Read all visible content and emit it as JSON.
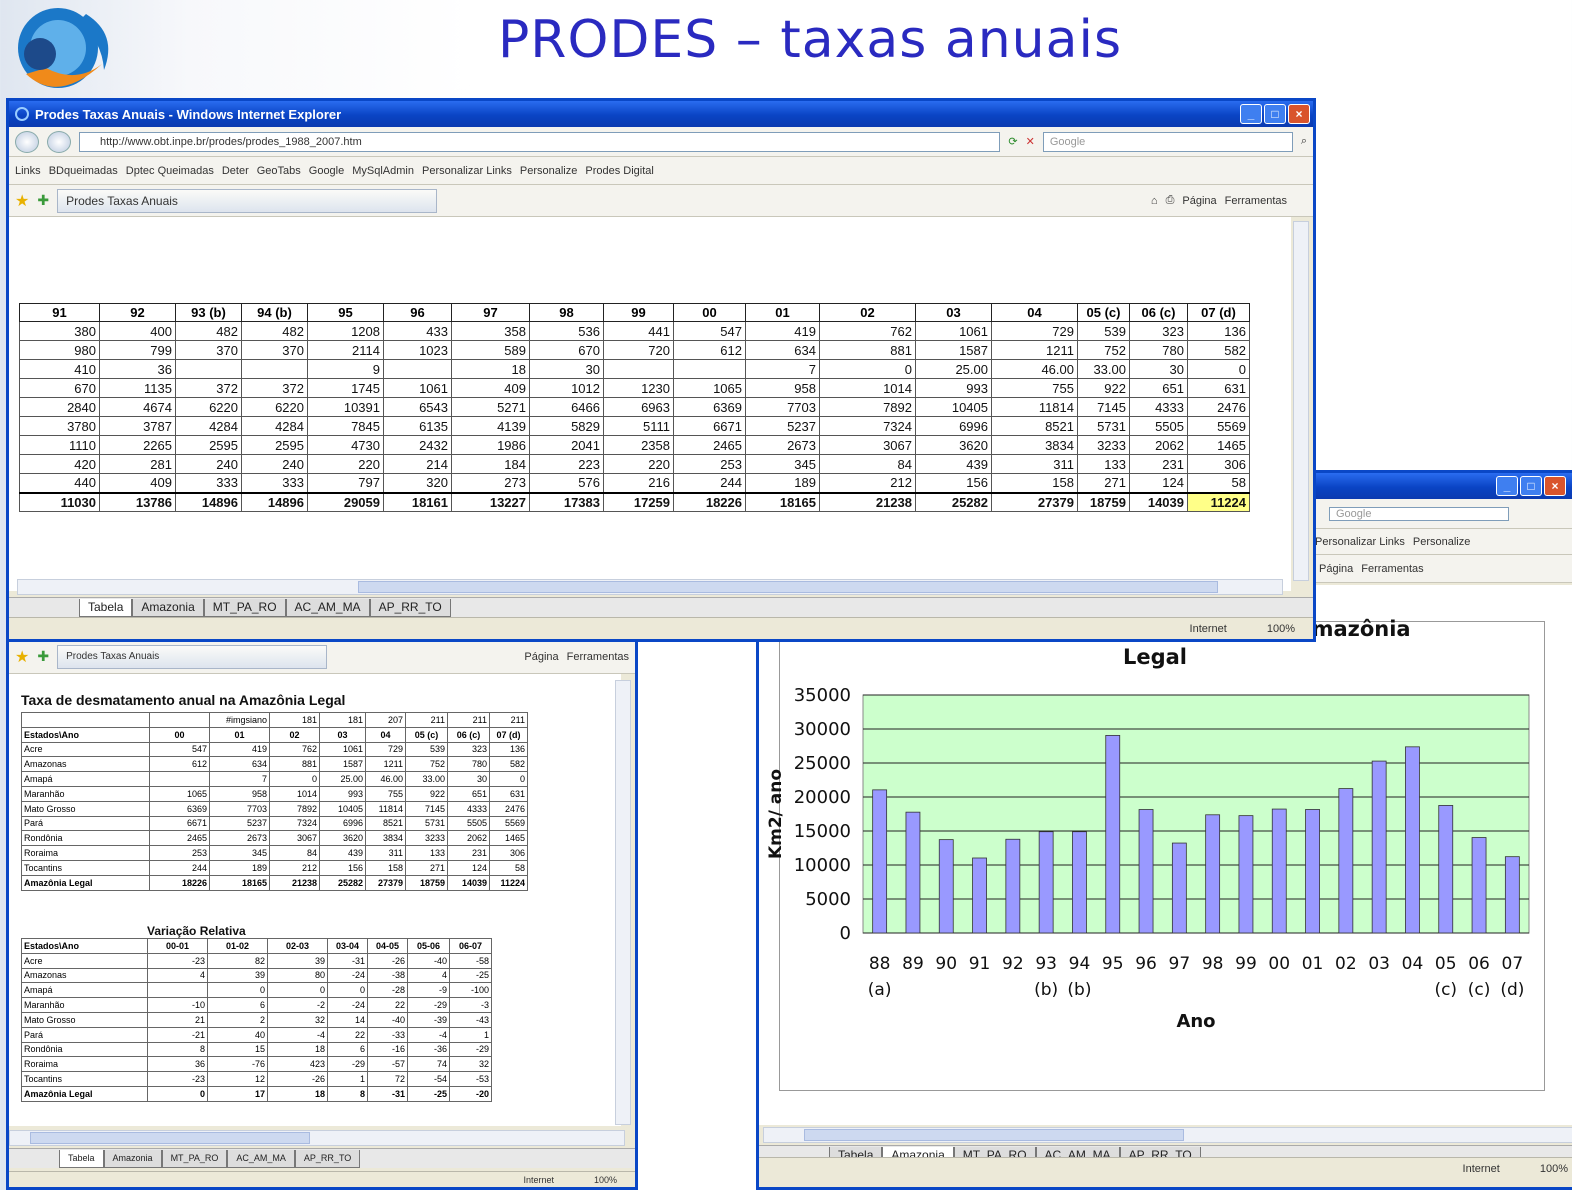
{
  "slide": {
    "title": "PRODES – taxas anuais"
  },
  "main_window": {
    "title": "Prodes Taxas Anuais - Windows Internet Explorer",
    "address": "http://www.obt.inpe.br/prodes/prodes_1988_2007.htm",
    "search_placeholder": "Google",
    "links": [
      "Links",
      "BDqueimadas",
      "Dptec Queimadas",
      "Deter",
      "GeoTabs",
      "Google",
      "MySqlAdmin",
      "Personalizar Links",
      "Personalize",
      "Prodes Digital"
    ],
    "tab_label": "Prodes Taxas Anuais",
    "cmd": [
      "Página",
      "Ferramentas"
    ],
    "status_zone": "Internet",
    "zoom": "100%",
    "sheet_tabs": [
      "Tabela",
      "Amazonia",
      "MT_PA_RO",
      "AC_AM_MA",
      "AP_RR_TO"
    ],
    "table": {
      "headers": [
        "91",
        "92",
        "93 (b)",
        "94 (b)",
        "95",
        "96",
        "97",
        "98",
        "99",
        "00",
        "01",
        "02",
        "03",
        "04",
        "05 (c)",
        "06 (c)",
        "07 (d)"
      ],
      "rows": [
        [
          "380",
          "400",
          "482",
          "482",
          "1208",
          "433",
          "358",
          "536",
          "441",
          "547",
          "419",
          "762",
          "1061",
          "729",
          "539",
          "323",
          "136"
        ],
        [
          "980",
          "799",
          "370",
          "370",
          "2114",
          "1023",
          "589",
          "670",
          "720",
          "612",
          "634",
          "881",
          "1587",
          "1211",
          "752",
          "780",
          "582"
        ],
        [
          "410",
          "36",
          "",
          "",
          "9",
          "",
          "18",
          "30",
          "",
          "",
          "7",
          "0",
          "25.00",
          "46.00",
          "33.00",
          "30",
          "0"
        ],
        [
          "670",
          "1135",
          "372",
          "372",
          "1745",
          "1061",
          "409",
          "1012",
          "1230",
          "1065",
          "958",
          "1014",
          "993",
          "755",
          "922",
          "651",
          "631"
        ],
        [
          "2840",
          "4674",
          "6220",
          "6220",
          "10391",
          "6543",
          "5271",
          "6466",
          "6963",
          "6369",
          "7703",
          "7892",
          "10405",
          "11814",
          "7145",
          "4333",
          "2476"
        ],
        [
          "3780",
          "3787",
          "4284",
          "4284",
          "7845",
          "6135",
          "4139",
          "5829",
          "5111",
          "6671",
          "5237",
          "7324",
          "6996",
          "8521",
          "5731",
          "5505",
          "5569"
        ],
        [
          "1110",
          "2265",
          "2595",
          "2595",
          "4730",
          "2432",
          "1986",
          "2041",
          "2358",
          "2465",
          "2673",
          "3067",
          "3620",
          "3834",
          "3233",
          "2062",
          "1465"
        ],
        [
          "420",
          "281",
          "240",
          "240",
          "220",
          "214",
          "184",
          "223",
          "220",
          "253",
          "345",
          "84",
          "439",
          "311",
          "133",
          "231",
          "306"
        ],
        [
          "440",
          "409",
          "333",
          "333",
          "797",
          "320",
          "273",
          "576",
          "216",
          "244",
          "189",
          "212",
          "156",
          "158",
          "271",
          "124",
          "58"
        ]
      ],
      "totals": [
        "11030",
        "13786",
        "14896",
        "14896",
        "29059",
        "18161",
        "13227",
        "17383",
        "17259",
        "18226",
        "18165",
        "21238",
        "25282",
        "27379",
        "18759",
        "14039",
        "11224"
      ]
    }
  },
  "left_window": {
    "tab_label": "Prodes Taxas Anuais",
    "cmd": [
      "Página",
      "Ferramentas"
    ],
    "status_zone": "Internet",
    "zoom": "100%",
    "sheet_tabs": [
      "Tabela",
      "Amazonia",
      "MT_PA_RO",
      "AC_AM_MA",
      "AP_RR_TO"
    ],
    "table1": {
      "title": "Taxa de desmatamento anual  na Amazônia Legal",
      "pre": [
        "#imgsiano",
        "181",
        "181",
        "207",
        "211",
        "211",
        "211"
      ],
      "headers": [
        "Estados\\Ano",
        "00",
        "01",
        "02",
        "03",
        "04",
        "05 (c)",
        "06 (c)",
        "07 (d)"
      ],
      "rows": [
        [
          "Acre",
          "547",
          "419",
          "762",
          "1061",
          "729",
          "539",
          "323",
          "136"
        ],
        [
          "Amazonas",
          "612",
          "634",
          "881",
          "1587",
          "1211",
          "752",
          "780",
          "582"
        ],
        [
          "Amapá",
          "",
          "7",
          "0",
          "25.00",
          "46.00",
          "33.00",
          "30",
          "0"
        ],
        [
          "Maranhão",
          "1065",
          "958",
          "1014",
          "993",
          "755",
          "922",
          "651",
          "631"
        ],
        [
          "Mato Grosso",
          "6369",
          "7703",
          "7892",
          "10405",
          "11814",
          "7145",
          "4333",
          "2476"
        ],
        [
          "Pará",
          "6671",
          "5237",
          "7324",
          "6996",
          "8521",
          "5731",
          "5505",
          "5569"
        ],
        [
          "Rondônia",
          "2465",
          "2673",
          "3067",
          "3620",
          "3834",
          "3233",
          "2062",
          "1465"
        ],
        [
          "Roraima",
          "253",
          "345",
          "84",
          "439",
          "311",
          "133",
          "231",
          "306"
        ],
        [
          "Tocantins",
          "244",
          "189",
          "212",
          "156",
          "158",
          "271",
          "124",
          "58"
        ]
      ],
      "total": [
        "Amazônia Legal",
        "18226",
        "18165",
        "21238",
        "25282",
        "27379",
        "18759",
        "14039",
        "11224"
      ]
    },
    "table2": {
      "title": "Variação Relativa",
      "headers": [
        "Estados\\Ano",
        "00-01",
        "01-02",
        "02-03",
        "03-04",
        "04-05",
        "05-06",
        "06-07"
      ],
      "rows": [
        [
          "Acre",
          "-23",
          "82",
          "39",
          "-31",
          "-26",
          "-40",
          "-58"
        ],
        [
          "Amazonas",
          "4",
          "39",
          "80",
          "-24",
          "-38",
          "4",
          "-25"
        ],
        [
          "Amapá",
          "",
          "0",
          "0",
          "0",
          "-28",
          "-9",
          "-100"
        ],
        [
          "Maranhão",
          "-10",
          "6",
          "-2",
          "-24",
          "22",
          "-29",
          "-3"
        ],
        [
          "Mato Grosso",
          "21",
          "2",
          "32",
          "14",
          "-40",
          "-39",
          "-43"
        ],
        [
          "Pará",
          "-21",
          "40",
          "-4",
          "22",
          "-33",
          "-4",
          "1"
        ],
        [
          "Rondônia",
          "8",
          "15",
          "18",
          "6",
          "-16",
          "-36",
          "-29"
        ],
        [
          "Roraima",
          "36",
          "-76",
          "423",
          "-29",
          "-57",
          "74",
          "32"
        ],
        [
          "Tocantins",
          "-23",
          "12",
          "-26",
          "1",
          "72",
          "-54",
          "-53"
        ]
      ],
      "total": [
        "Amazônia Legal",
        "0",
        "17",
        "18",
        "8",
        "-31",
        "-25",
        "-20"
      ]
    }
  },
  "right_window": {
    "search_placeholder": "Google",
    "links": [
      "Personalizar Links",
      "Personalize"
    ],
    "cmd": [
      "Página",
      "Ferramentas"
    ],
    "status_zone": "Internet",
    "zoom": "100%",
    "sheet_tabs": [
      "Tabela",
      "Amazonia",
      "MT_PA_RO",
      "AC_AM_MA",
      "AP_RR_TO"
    ]
  },
  "chart_data": {
    "type": "bar",
    "title": "Taxa de Desmatamento Anual na Amazônia Legal",
    "title_line1": "Taxa de Desmatamento Anual na Amazônia",
    "title_line2": "Legal",
    "xlabel": "Ano",
    "ylabel": "Km2/ ano",
    "categories": [
      "88",
      "89",
      "90",
      "91",
      "92",
      "93",
      "94",
      "95",
      "96",
      "97",
      "98",
      "99",
      "00",
      "01",
      "02",
      "03",
      "04",
      "05",
      "06",
      "07"
    ],
    "notes": [
      "(a)",
      "",
      "",
      "",
      "",
      "(b)",
      "(b)",
      "",
      "",
      "",
      "",
      "",
      "",
      "",
      "",
      "",
      "",
      "(c)",
      "(c)",
      "(d)"
    ],
    "values": [
      21050,
      17770,
      13730,
      11030,
      13786,
      14896,
      14896,
      29059,
      18161,
      13227,
      17383,
      17259,
      18226,
      18165,
      21238,
      25282,
      27379,
      18759,
      14039,
      11224
    ],
    "ylim": [
      0,
      35000
    ],
    "yticks": [
      "0",
      "5000",
      "10000",
      "15000",
      "20000",
      "25000",
      "30000",
      "35000"
    ],
    "colors": {
      "bar": "#9999ff",
      "plot_bg": "#ccffcc"
    },
    "grid": true,
    "legend": "none"
  }
}
